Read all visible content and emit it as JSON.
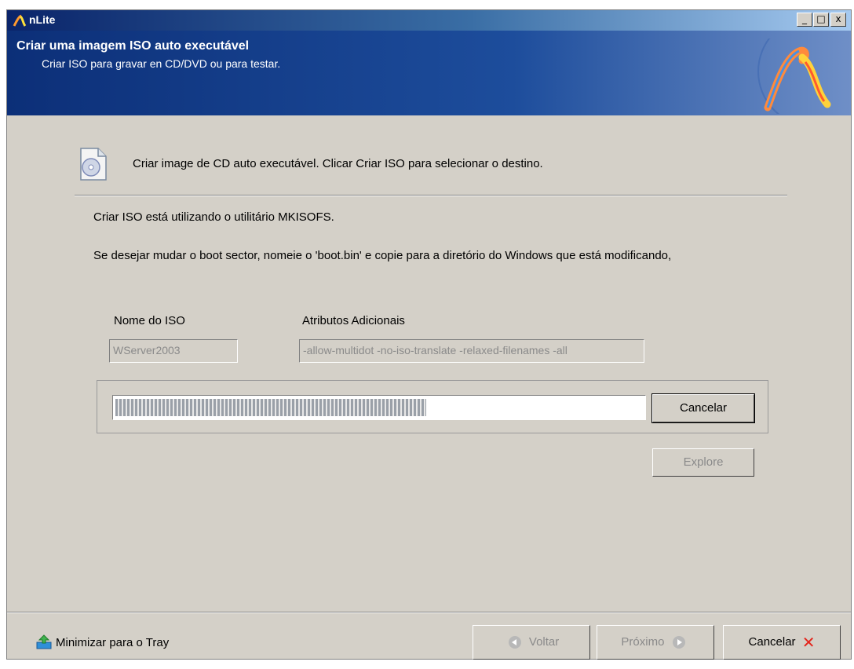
{
  "window": {
    "title": "nLite",
    "minimize": "_",
    "maximize": "□",
    "close": "x"
  },
  "header": {
    "title": "Criar uma imagem ISO auto executável",
    "subtitle": "Criar ISO para gravar en CD/DVD ou para testar."
  },
  "intro": {
    "text": "Criar image de CD auto executável. Clicar Criar ISO para selecionar o destino."
  },
  "info": {
    "line1": "Criar ISO está utilizando o utilitário MKISOFS.",
    "line2": "Se desejar mudar o boot sector, nomeie o 'boot.bin' e copie para a diretório do Windows que está modificando,"
  },
  "iso": {
    "name_label": "Nome do ISO",
    "name_value": "WServer2003",
    "attr_label": "Atributos Adicionais",
    "attr_value": "-allow-multidot -no-iso-translate -relaxed-filenames -all"
  },
  "progress": {
    "fraction": 0.59
  },
  "buttons": {
    "cancel_iso": "Cancelar",
    "explore": "Explore"
  },
  "footer": {
    "tray_label": "Minimizar para o Tray",
    "back": "Voltar",
    "next": "Próximo",
    "cancel": "Cancelar"
  }
}
